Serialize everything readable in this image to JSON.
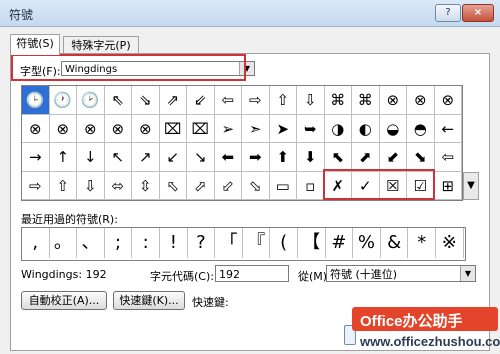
{
  "window": {
    "title": "符號",
    "help_glyph": "?",
    "close_glyph": "×"
  },
  "tabs": [
    {
      "label": "符號(S)"
    },
    {
      "label": "特殊字元(P)"
    }
  ],
  "font": {
    "label": "字型(F):",
    "value": "Wingdings",
    "arrow": "▼"
  },
  "symbol_grid": [
    [
      "🕒",
      "🕐",
      "🕑",
      "⇖",
      "⇘",
      "⇗",
      "⇙",
      "⇦",
      "⇨",
      "⇧",
      "⇩",
      "⌘",
      "⌘",
      "⊗",
      "⊗",
      "⊗"
    ],
    [
      "⊗",
      "⊗",
      "⊗",
      "⊗",
      "⊗",
      "⌧",
      "⌧",
      "➢",
      "➣",
      "➤",
      "➥",
      "◑",
      "◐",
      "◒",
      "◓",
      "←"
    ],
    [
      "→",
      "↑",
      "↓",
      "↖",
      "↗",
      "↙",
      "↘",
      "⬅",
      "➡",
      "⬆",
      "⬇",
      "⬉",
      "⬈",
      "⬋",
      "⬊",
      "⇦"
    ],
    [
      "⇨",
      "⇧",
      "⇩",
      "⬄",
      "⇳",
      "⬁",
      "⬀",
      "⬃",
      "⬂",
      "▭",
      "▫",
      "✗",
      "✓",
      "☒",
      "☑",
      "⊞"
    ]
  ],
  "scroll_glyph": "▼",
  "recent": {
    "label": "最近用過的符號(R):",
    "symbols": [
      ",",
      "。",
      "、",
      ";",
      ":",
      "!",
      "?",
      "「",
      "『",
      "(",
      "【",
      "#",
      "%",
      "&",
      "*",
      "※"
    ]
  },
  "info": {
    "char_name": "Wingdings: 192",
    "code_label": "字元代碼(C):",
    "code_value": "192",
    "from_label": "從(M):",
    "from_value": "符號 (十進位)",
    "from_arrow": "▼"
  },
  "buttons": {
    "autocorrect": "自動校正(A)...",
    "shortcut_key": "快速鍵(K)...",
    "shortcut_label": "快速鍵:"
  },
  "watermark": {
    "brand": "Office办公助手",
    "url": "www.officezhushou.com"
  },
  "colors": {
    "highlight": "#d0323a",
    "selection": "#2f6fd5",
    "brand": "#e4452a"
  }
}
